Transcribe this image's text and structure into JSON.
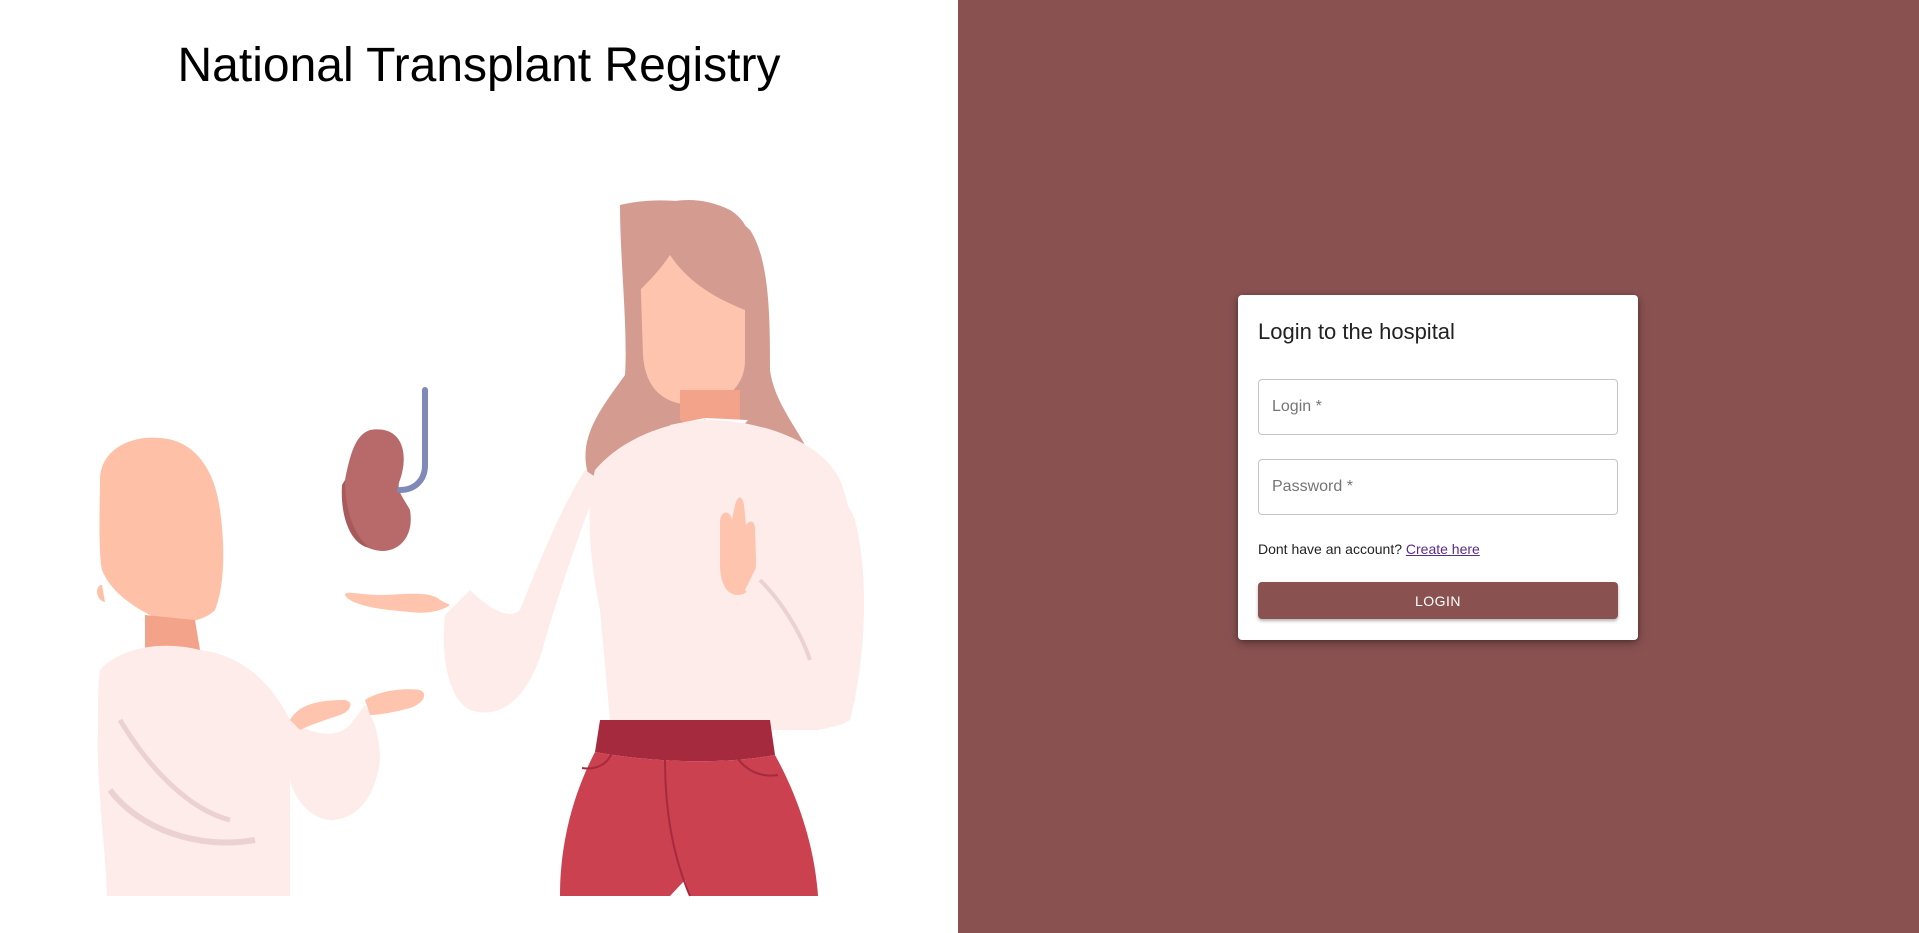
{
  "header": {
    "title": "National Transplant Registry"
  },
  "illustration": {
    "description_icon": "kidney-donation-illustration-icon"
  },
  "login": {
    "title": "Login to the hospital",
    "login_placeholder": "Login *",
    "password_placeholder": "Password *",
    "login_value": "",
    "password_value": "",
    "account_prompt": "Dont have an account?",
    "create_link": "Create here",
    "button_label": "LOGIN"
  },
  "colors": {
    "brand": "#8a5151",
    "background_left": "#ffffff",
    "link": "#5b2b8a"
  }
}
